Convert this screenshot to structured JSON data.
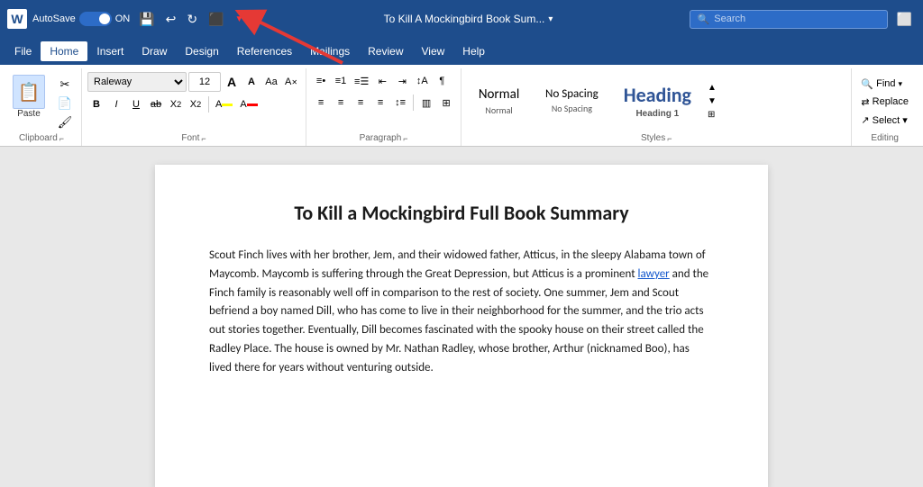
{
  "titlebar": {
    "logo": "W",
    "autosave_label": "AutoSave",
    "toggle_state": "ON",
    "doc_title": "To Kill A Mockingbird Book Sum...",
    "search_placeholder": "Search",
    "undo_icon": "↩",
    "redo_icon": "↻"
  },
  "menubar": {
    "items": [
      "File",
      "Home",
      "Insert",
      "Draw",
      "Design",
      "References",
      "Mailings",
      "Review",
      "View",
      "Help"
    ],
    "active": "Home"
  },
  "ribbon": {
    "clipboard": {
      "label": "Clipboard",
      "paste_label": "Paste",
      "cut_label": "Cut",
      "copy_label": "Copy",
      "format_painter_label": "Format Painter"
    },
    "font": {
      "label": "Font",
      "font_name": "Raleway",
      "font_size": "12",
      "grow_label": "A",
      "shrink_label": "A",
      "case_label": "Aa",
      "clear_label": "A",
      "bold_label": "B",
      "italic_label": "I",
      "underline_label": "U",
      "strikethrough_label": "ab",
      "subscript_label": "X₂",
      "superscript_label": "X²",
      "font_color_label": "A",
      "highlight_label": "A",
      "font_color_color": "#ff0000",
      "highlight_color": "#ffff00"
    },
    "paragraph": {
      "label": "Paragraph",
      "bullets_label": "≡•",
      "numbered_label": "≡1",
      "multilevel_label": "≡",
      "decrease_indent_label": "⇤",
      "increase_indent_label": "⇥",
      "sort_label": "↕Z",
      "show_marks_label": "¶",
      "align_left_label": "≡",
      "align_center_label": "≡",
      "align_right_label": "≡",
      "justify_label": "≡",
      "line_spacing_label": "↕",
      "shading_label": "▥",
      "borders_label": "□"
    },
    "styles": {
      "label": "Styles",
      "normal_label": "Normal",
      "no_spacing_label": "No Spacing",
      "heading_label": "Heading 1",
      "heading_display": "Heading",
      "expand_label": "▼",
      "launcher_label": "⌐"
    },
    "editing": {
      "label": "Editing",
      "find_label": "Find",
      "replace_label": "Replace",
      "select_label": "Select ▾"
    }
  },
  "document": {
    "title": "To Kill a Mockingbird Full Book Summary",
    "body": "Scout Finch lives with her brother, Jem, and their widowed father, Atticus, in the sleepy Alabama town of Maycomb. Maycomb is suffering through the Great Depression, but Atticus is a prominent ",
    "link_text": "lawyer",
    "body_cont": " and the Finch family is reasonably well off in comparison to the rest of society. One summer, Jem and Scout befriend a boy named Dill, who has come to live in their neighborhood for the summer, and the trio acts out stories together. Eventually, Dill becomes fascinated with the spooky house on their street called the Radley Place. The house is owned by Mr. Nathan Radley, whose brother, Arthur (nicknamed Boo), has lived there for years without venturing outside."
  }
}
